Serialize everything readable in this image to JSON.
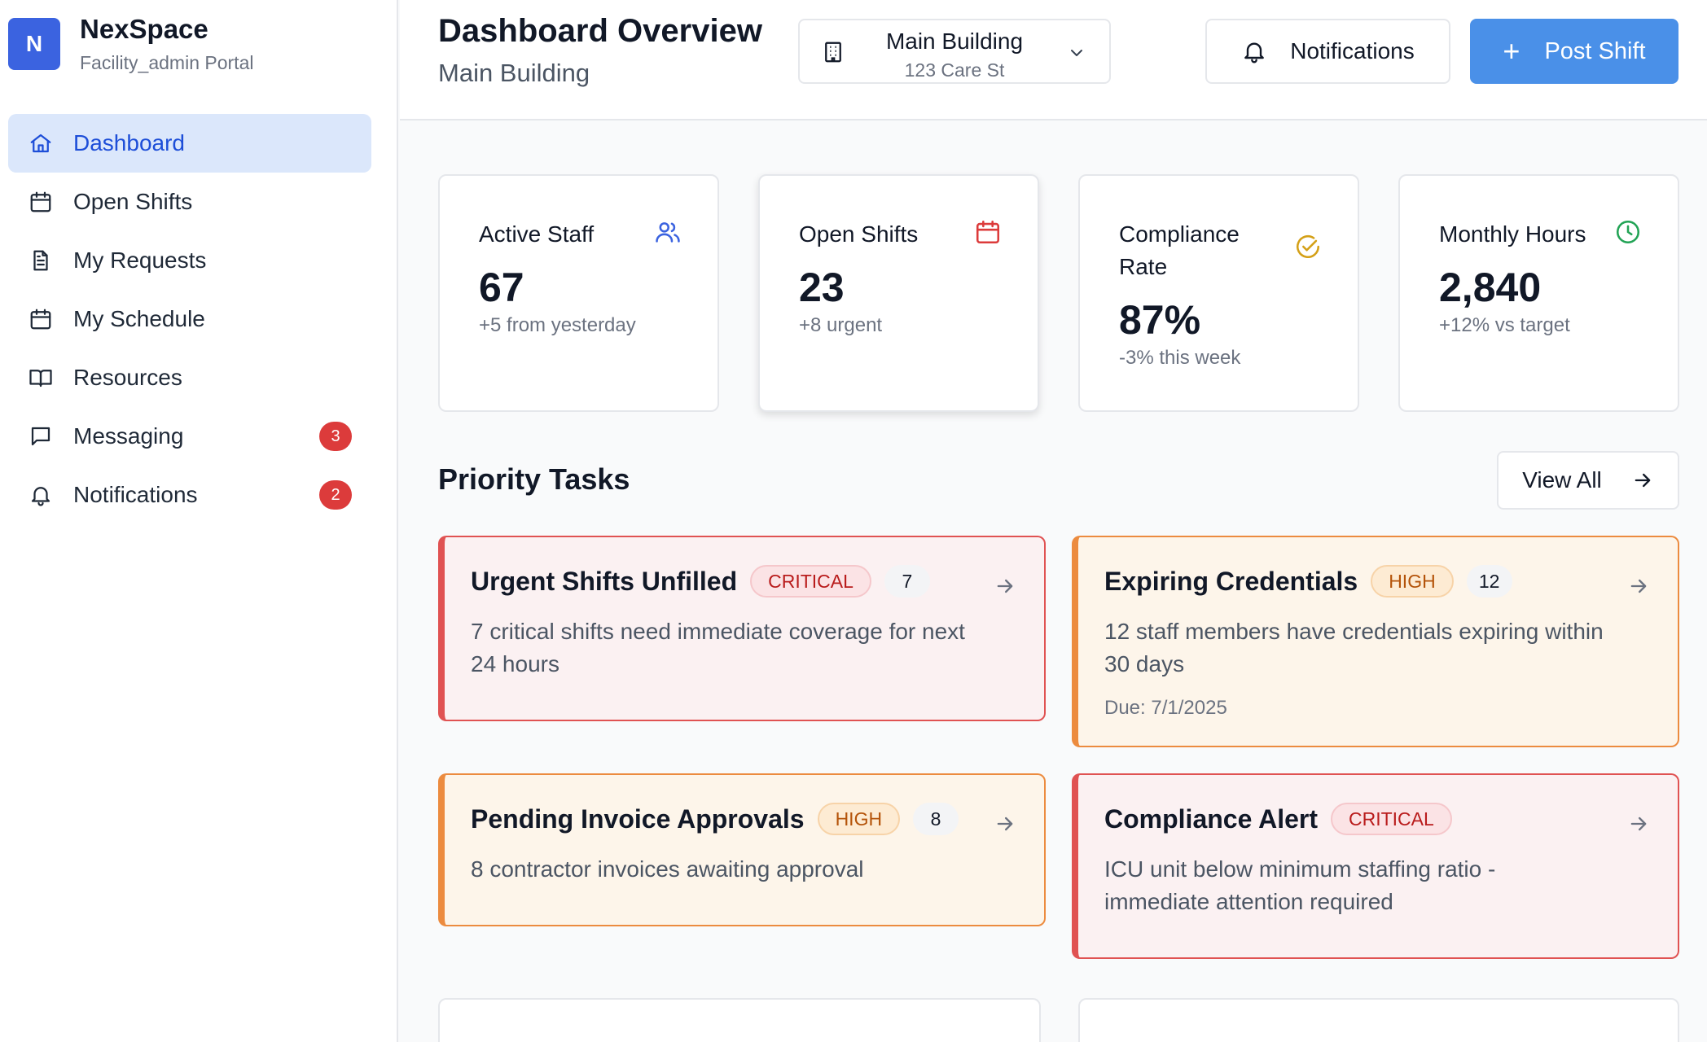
{
  "brand": {
    "logo_letter": "N",
    "name": "NexSpace",
    "subtitle": "Facility_admin Portal",
    "accent": "#3b63e0"
  },
  "sidebar": {
    "items": [
      {
        "label": "Dashboard",
        "icon": "home-icon",
        "active": true
      },
      {
        "label": "Open Shifts",
        "icon": "calendar-icon"
      },
      {
        "label": "My Requests",
        "icon": "document-icon"
      },
      {
        "label": "My Schedule",
        "icon": "calendar-icon"
      },
      {
        "label": "Resources",
        "icon": "book-icon"
      },
      {
        "label": "Messaging",
        "icon": "message-icon",
        "badge": "3"
      },
      {
        "label": "Notifications",
        "icon": "bell-icon",
        "badge": "2"
      }
    ]
  },
  "header": {
    "title": "Dashboard Overview",
    "subtitle": "Main Building",
    "building_select": {
      "name": "Main Building",
      "address": "123 Care St"
    },
    "notifications_label": "Notifications",
    "post_shift_label": "Post Shift"
  },
  "stats": [
    {
      "label": "Active Staff",
      "value": "67",
      "delta": "+5 from yesterday",
      "icon": "users-icon",
      "color": "#3b63e0"
    },
    {
      "label": "Open Shifts",
      "value": "23",
      "delta": "+8 urgent",
      "icon": "calendar-icon",
      "color": "#dc3b3b"
    },
    {
      "label": "Compliance Rate",
      "value": "87%",
      "delta": "-3% this week",
      "icon": "check-circle-icon",
      "color": "#d4a017"
    },
    {
      "label": "Monthly Hours",
      "value": "2,840",
      "delta": "+12% vs target",
      "icon": "clock-icon",
      "color": "#22a355"
    }
  ],
  "priority": {
    "title": "Priority Tasks",
    "view_all_label": "View All",
    "tasks": [
      {
        "title": "Urgent Shifts Unfilled",
        "priority": "CRITICAL",
        "count": "7",
        "description": "7 critical shifts need immediate coverage for next 24 hours"
      },
      {
        "title": "Expiring Credentials",
        "priority": "HIGH",
        "count": "12",
        "description": "12 staff members have credentials expiring within 30 days",
        "due": "Due: 7/1/2025"
      },
      {
        "title": "Pending Invoice Approvals",
        "priority": "HIGH",
        "count": "8",
        "description": "8 contractor invoices awaiting approval"
      },
      {
        "title": "Compliance Alert",
        "priority": "CRITICAL",
        "description": "ICU unit below minimum staffing ratio - immediate attention required"
      }
    ]
  }
}
